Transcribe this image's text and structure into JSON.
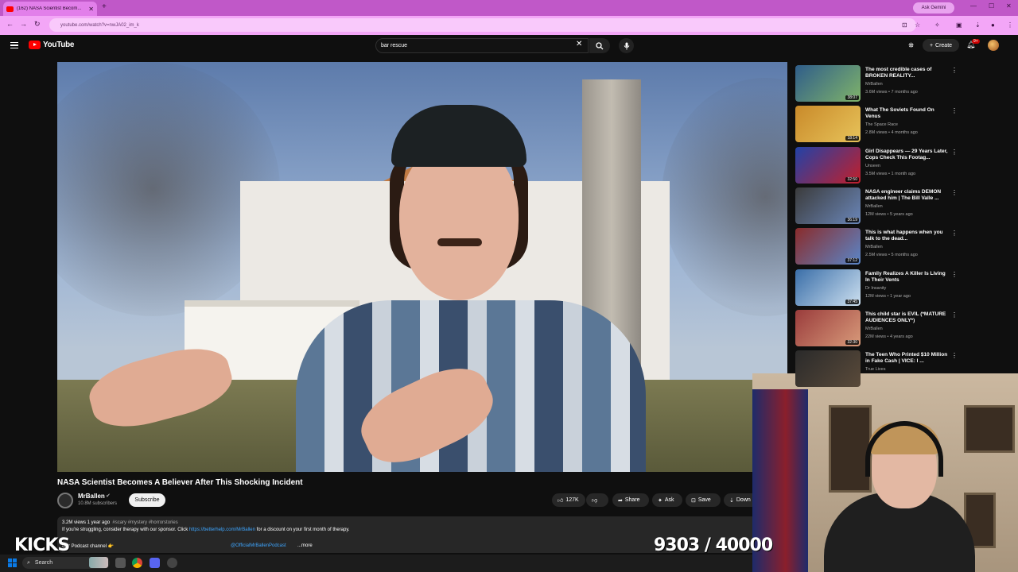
{
  "browser": {
    "tab_title": "(162) NASA Scientist Becom...",
    "new_tab": "+",
    "gemini_label": "Ask Gemini",
    "url": "youtube.com/watch?v=nwJA02_im_k"
  },
  "youtube": {
    "logo_text": "YouTube",
    "search_query": "bar rescue",
    "create_label": "Create",
    "notification_count": "9+"
  },
  "video": {
    "title": "NASA Scientist Becomes A Believer After This Shocking Incident",
    "channel": "MrBallen",
    "subscribers": "10.8M subscribers",
    "subscribe_label": "Subscribe",
    "likes": "127K",
    "share_label": "Share",
    "ask_label": "Ask",
    "save_label": "Save",
    "download_label": "Down",
    "views_age": "3.2M views  1 year ago",
    "hashtags": "#scary #mystery #horrorstories",
    "desc_line1_prefix": "If you're struggling, consider therapy with our sponsor. Click ",
    "desc_link1": "https://betterhelp.com/MrBallen",
    "desc_line1_suffix": " for a discount on your first month of therapy.",
    "desc_line2": "Our Podcast channel 👉",
    "desc_link2": "@OfficialMrBallenPodcast",
    "more_label": "...more"
  },
  "recommendations": [
    {
      "title": "The most credible cases of BROKEN REALITY...",
      "channel": "MrBallen",
      "meta": "3.6M views • 7 months ago",
      "duration": "38:07",
      "colors": [
        "#2f5d8a",
        "#7fb36a"
      ]
    },
    {
      "title": "What The Soviets Found On Venus",
      "channel": "The Space Race",
      "meta": "2.8M views • 4 months ago",
      "duration": "18:14",
      "colors": [
        "#c98a2a",
        "#e7c35a"
      ]
    },
    {
      "title": "Girl Disappears — 29 Years Later, Cops Check This Footag...",
      "channel": "Unseen",
      "meta": "3.5M views • 1 month ago",
      "duration": "32:50",
      "colors": [
        "#2142a8",
        "#c21f2a"
      ]
    },
    {
      "title": "NASA engineer claims DEMON attacked him | The Bill Valle ...",
      "channel": "MrBallen",
      "meta": "12M views • 5 years ago",
      "duration": "36:19",
      "colors": [
        "#3b3b3b",
        "#6a86b8"
      ]
    },
    {
      "title": "This is what happens when you talk to the dead...",
      "channel": "MrBallen",
      "meta": "2.5M views • 5 months ago",
      "duration": "37:12",
      "colors": [
        "#8a2b2b",
        "#5a86c8"
      ]
    },
    {
      "title": "Family Realizes A Killer Is Living In Their Vents",
      "channel": "Dr Insanity",
      "meta": "12M views • 1 year ago",
      "duration": "37:45",
      "colors": [
        "#3a6ea8",
        "#cde0f0"
      ]
    },
    {
      "title": "This child star is EVIL (*MATURE AUDIENCES ONLY*)",
      "channel": "MrBallen",
      "meta": "22M views • 4 years ago",
      "duration": "32:30",
      "colors": [
        "#9a3c3c",
        "#d89a7a"
      ]
    },
    {
      "title": "The Teen Who Printed $10 Million in Fake Cash | VICE: I ...",
      "channel": "True Lives",
      "meta": "",
      "duration": "",
      "colors": [
        "#2a2a2a",
        "#5a4a3a"
      ]
    }
  ],
  "overlays": {
    "kicks": "KICKS",
    "counter": "9303 / 40000"
  },
  "taskbar": {
    "search_label": "Search"
  }
}
